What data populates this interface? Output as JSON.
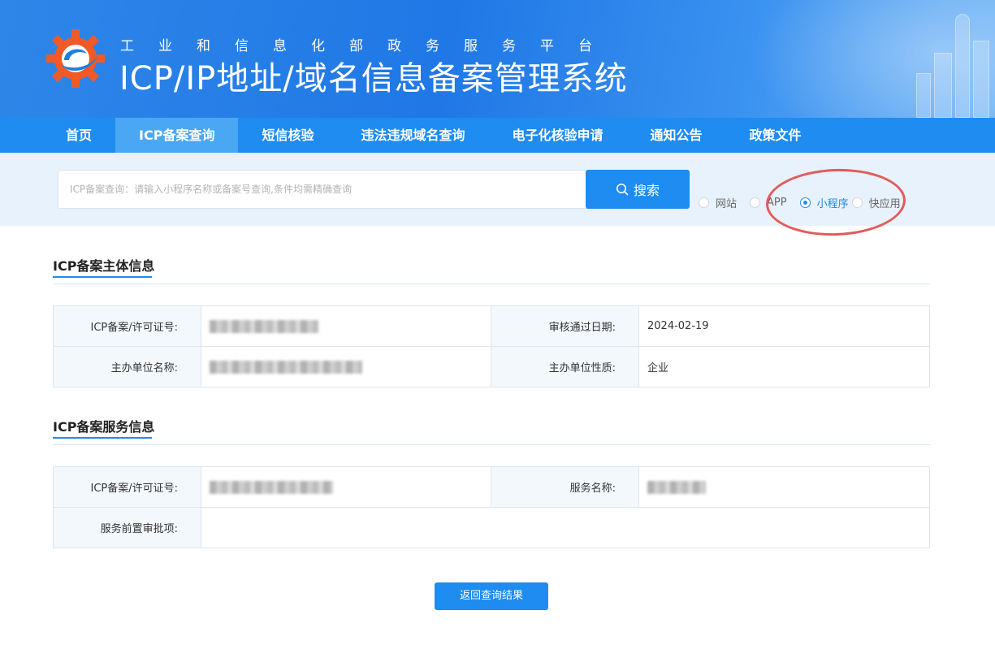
{
  "header": {
    "subtitle": "工业和信息化部政务服务平台",
    "title": "ICP/IP地址/域名信息备案管理系统"
  },
  "nav": {
    "items": [
      {
        "label": "首页",
        "active": false
      },
      {
        "label": "ICP备案查询",
        "active": true
      },
      {
        "label": "短信核验",
        "active": false
      },
      {
        "label": "违法违规域名查询",
        "active": false
      },
      {
        "label": "电子化核验申请",
        "active": false
      },
      {
        "label": "通知公告",
        "active": false
      },
      {
        "label": "政策文件",
        "active": false
      }
    ]
  },
  "search": {
    "placeholder": "ICP备案查询：请输入小程序名称或备案号查询,条件均需精确查询",
    "button_label": "搜索",
    "options": [
      {
        "label": "网站",
        "checked": false
      },
      {
        "label": "APP",
        "checked": false
      },
      {
        "label": "小程序",
        "checked": true
      },
      {
        "label": "快应用",
        "checked": false
      }
    ]
  },
  "subject_info": {
    "title": "ICP备案主体信息",
    "rows": [
      {
        "key1": "ICP备案/许可证号:",
        "val1": "",
        "key2": "审核通过日期:",
        "val2": "2024-02-19"
      },
      {
        "key1": "主办单位名称:",
        "val1": "",
        "key2": "主办单位性质:",
        "val2": "企业"
      }
    ]
  },
  "service_info": {
    "title": "ICP备案服务信息",
    "license_label": "ICP备案/许可证号:",
    "service_name_label": "服务名称:",
    "pre_approval_label": "服务前置审批项:",
    "pre_approval_value": ""
  },
  "back_button": "返回查询结果",
  "colors": {
    "primary": "#1e8cf0",
    "nav_active": "#4aa7f3",
    "search_bg": "#e7f2fd",
    "annotation": "#e45a5a"
  }
}
